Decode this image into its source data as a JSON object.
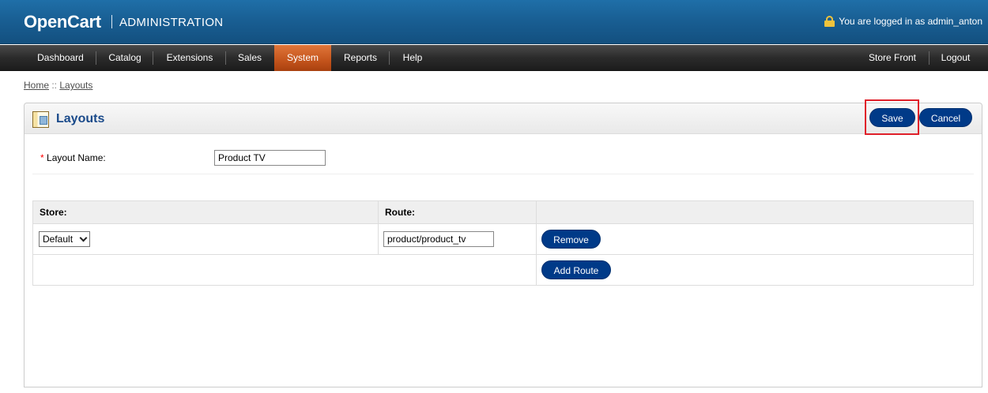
{
  "header": {
    "logo": "OpenCart",
    "subtitle": "ADMINISTRATION",
    "login_text": "You are logged in as admin_anton",
    "lock_icon": "lock-icon",
    "lock_color": "#f0c33c"
  },
  "menu": {
    "items": [
      "Dashboard",
      "Catalog",
      "Extensions",
      "Sales",
      "System",
      "Reports",
      "Help"
    ],
    "active": "System",
    "active_color": "#c4541c",
    "right": [
      "Store Front",
      "Logout"
    ]
  },
  "breadcrumb": {
    "home": "Home",
    "sep": " :: ",
    "current": "Layouts"
  },
  "box": {
    "title": "Layouts",
    "icon": "layout-icon",
    "save_label": "Save",
    "cancel_label": "Cancel",
    "button_color": "#003a88",
    "highlight_color": "#e0202a"
  },
  "form": {
    "required_mark": "*",
    "layout_name_label": "Layout Name:",
    "layout_name_value": "Product TV"
  },
  "routes": {
    "store_header": "Store:",
    "route_header": "Route:",
    "rows": [
      {
        "store": "Default",
        "route": "product/product_tv",
        "remove_label": "Remove"
      }
    ],
    "add_route_label": "Add Route"
  }
}
